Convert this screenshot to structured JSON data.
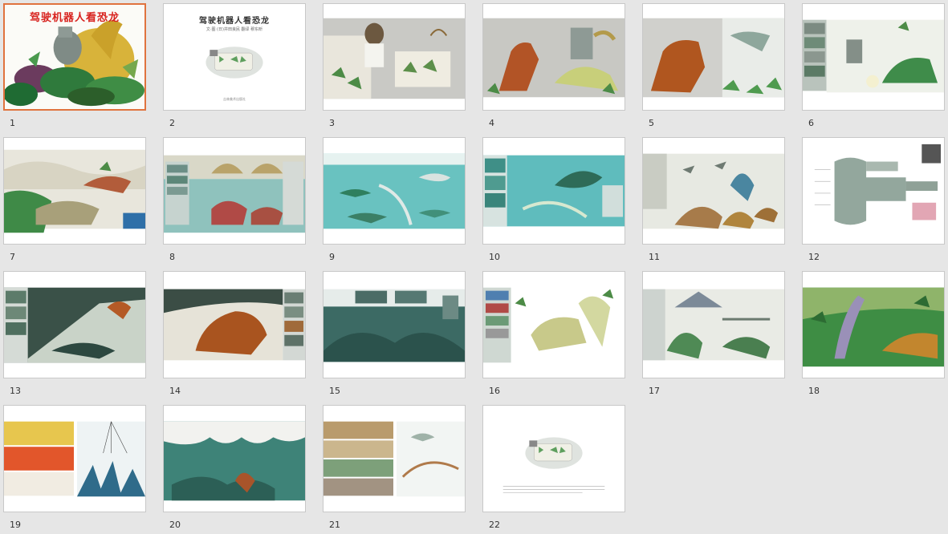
{
  "colors": {
    "background": "#e6e6e6",
    "selection": "#e0733e",
    "cover_title": "#d8231f"
  },
  "cover": {
    "title": "驾驶机器人看恐龙"
  },
  "title_page": {
    "title": "驾驶机器人看恐龙",
    "credits": "文·图 (日)井田良民    翻译 穆东昕",
    "publisher": "吉林美术出版社"
  },
  "slides": [
    {
      "num": "1"
    },
    {
      "num": "2"
    },
    {
      "num": "3"
    },
    {
      "num": "4"
    },
    {
      "num": "5"
    },
    {
      "num": "6"
    },
    {
      "num": "7"
    },
    {
      "num": "8"
    },
    {
      "num": "9"
    },
    {
      "num": "10"
    },
    {
      "num": "11"
    },
    {
      "num": "12"
    },
    {
      "num": "13"
    },
    {
      "num": "14"
    },
    {
      "num": "15"
    },
    {
      "num": "16"
    },
    {
      "num": "17"
    },
    {
      "num": "18"
    },
    {
      "num": "19"
    },
    {
      "num": "20"
    },
    {
      "num": "21"
    },
    {
      "num": "22"
    }
  ]
}
